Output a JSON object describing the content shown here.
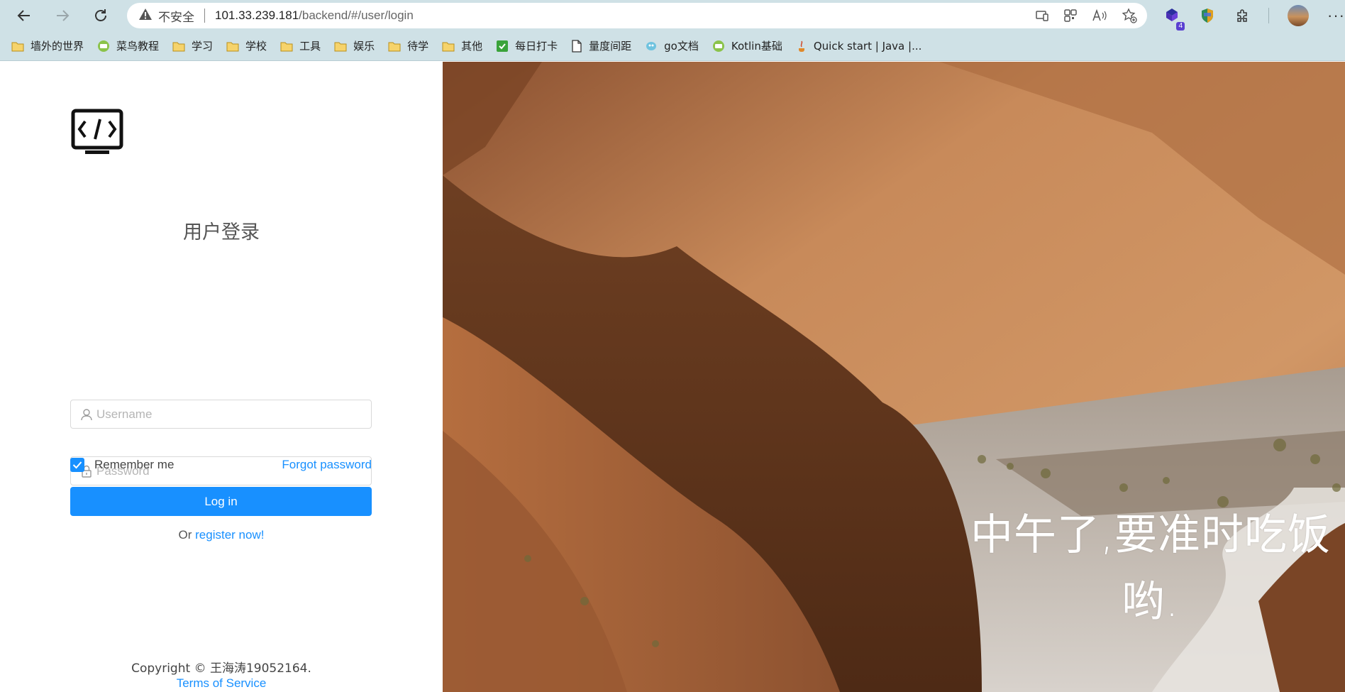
{
  "browser": {
    "address": {
      "insecure_label": "不安全",
      "url_host": "101.33.239.181",
      "url_path": "/backend/#/user/login"
    },
    "extension_badge": "4",
    "bookmarks": [
      {
        "label": "墙外的世界",
        "icon": "folder-icon"
      },
      {
        "label": "菜鸟教程",
        "icon": "runoob-icon"
      },
      {
        "label": "学习",
        "icon": "folder-icon"
      },
      {
        "label": "学校",
        "icon": "folder-icon"
      },
      {
        "label": "工具",
        "icon": "folder-icon"
      },
      {
        "label": "娱乐",
        "icon": "folder-icon"
      },
      {
        "label": "待学",
        "icon": "folder-icon"
      },
      {
        "label": "其他",
        "icon": "folder-icon"
      },
      {
        "label": "每日打卡",
        "icon": "checkin-icon"
      },
      {
        "label": "量度间距",
        "icon": "page-icon"
      },
      {
        "label": "go文档",
        "icon": "go-icon"
      },
      {
        "label": "Kotlin基础",
        "icon": "runoob-icon"
      },
      {
        "label": "Quick start | Java |...",
        "icon": "java-icon"
      }
    ]
  },
  "login": {
    "title": "用户登录",
    "username_placeholder": "Username",
    "password_placeholder": "Password",
    "remember_label": "Remember me",
    "remember_checked": true,
    "forgot_label": "Forgot password",
    "login_button": "Log in",
    "register_prefix": "Or ",
    "register_link": "register now!",
    "copyright": "Copyright © 王海涛19052164.",
    "terms": "Terms of Service"
  },
  "hero": {
    "quote_line1": "中午了,要准时吃饭",
    "quote_line2": "哟."
  },
  "colors": {
    "primary": "#1890ff",
    "chrome": "#cfe1e6"
  }
}
